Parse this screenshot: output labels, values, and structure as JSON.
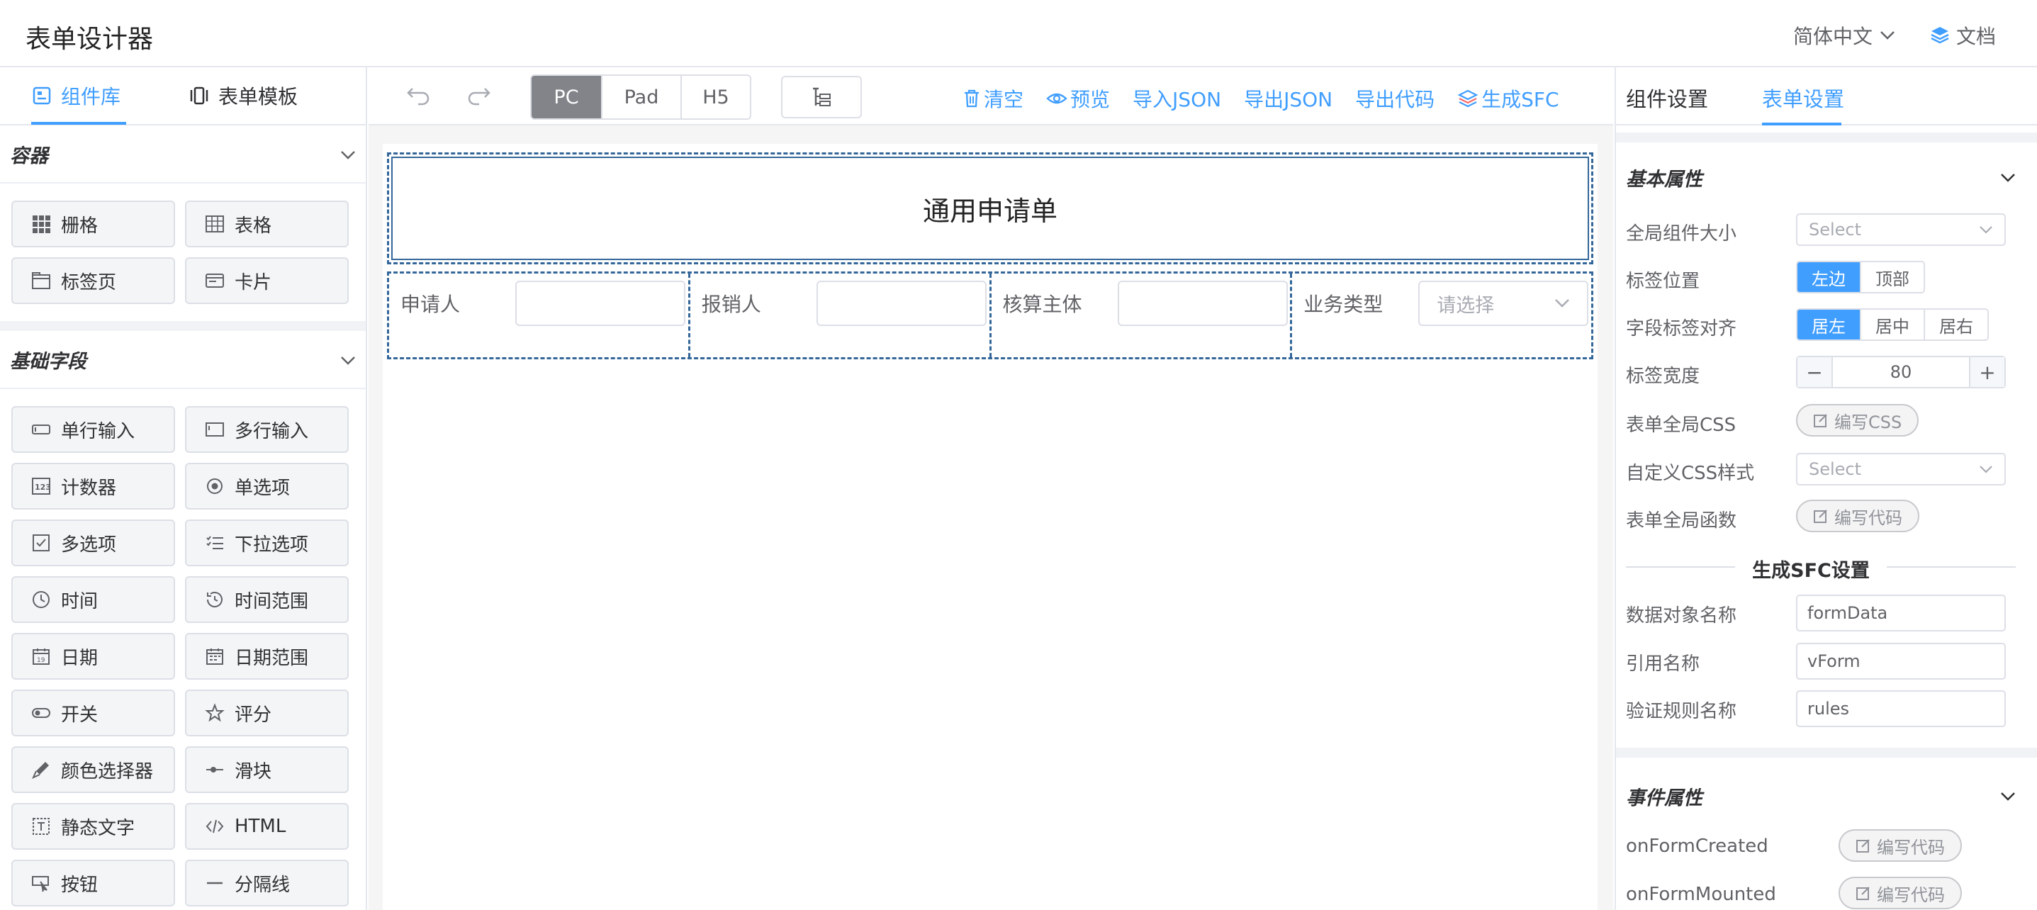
{
  "app": {
    "title": "表单设计器",
    "lang": "简体中文",
    "docs": "文档"
  },
  "left": {
    "tabs": [
      {
        "label": "组件库",
        "icon": "component-icon"
      },
      {
        "label": "表单模板",
        "icon": "template-icon"
      }
    ],
    "groups": [
      {
        "title": "容器",
        "items": [
          {
            "label": "栅格",
            "icon": "grid-icon"
          },
          {
            "label": "表格",
            "icon": "table-icon"
          },
          {
            "label": "标签页",
            "icon": "tab-icon"
          },
          {
            "label": "卡片",
            "icon": "card-icon"
          }
        ]
      },
      {
        "title": "基础字段",
        "items": [
          {
            "label": "单行输入",
            "icon": "text-input-icon"
          },
          {
            "label": "多行输入",
            "icon": "textarea-icon"
          },
          {
            "label": "计数器",
            "icon": "number-icon"
          },
          {
            "label": "单选项",
            "icon": "radio-icon"
          },
          {
            "label": "多选项",
            "icon": "checkbox-icon"
          },
          {
            "label": "下拉选项",
            "icon": "select-icon"
          },
          {
            "label": "时间",
            "icon": "clock-icon"
          },
          {
            "label": "时间范围",
            "icon": "time-range-icon"
          },
          {
            "label": "日期",
            "icon": "calendar-icon"
          },
          {
            "label": "日期范围",
            "icon": "date-range-icon"
          },
          {
            "label": "开关",
            "icon": "switch-icon"
          },
          {
            "label": "评分",
            "icon": "star-icon"
          },
          {
            "label": "颜色选择器",
            "icon": "color-picker-icon"
          },
          {
            "label": "滑块",
            "icon": "slider-icon"
          },
          {
            "label": "静态文字",
            "icon": "static-text-icon"
          },
          {
            "label": "HTML",
            "icon": "code-icon"
          },
          {
            "label": "按钮",
            "icon": "button-icon"
          },
          {
            "label": "分隔线",
            "icon": "divider-icon"
          }
        ]
      }
    ]
  },
  "toolbar": {
    "devices": [
      "PC",
      "Pad",
      "H5"
    ],
    "active_device": "PC",
    "actions": [
      "清空",
      "预览",
      "导入JSON",
      "导出JSON",
      "导出代码",
      "生成SFC"
    ]
  },
  "canvas": {
    "form_title": "通用申请单",
    "fields": [
      {
        "label": "申请人",
        "type": "input"
      },
      {
        "label": "报销人",
        "type": "input"
      },
      {
        "label": "核算主体",
        "type": "input"
      },
      {
        "label": "业务类型",
        "type": "select",
        "placeholder": "请选择"
      }
    ]
  },
  "right": {
    "tabs": [
      "组件设置",
      "表单设置"
    ],
    "active_tab": "表单设置",
    "basic_title": "基本属性",
    "props": {
      "size_label": "全局组件大小",
      "size_placeholder": "Select",
      "label_pos_label": "标签位置",
      "label_pos_options": [
        "左边",
        "顶部"
      ],
      "label_align_label": "字段标签对齐",
      "label_align_options": [
        "居左",
        "居中",
        "居右"
      ],
      "label_width_label": "标签宽度",
      "label_width_value": "80",
      "css_label": "表单全局CSS",
      "css_button": "编写CSS",
      "custom_css_label": "自定义CSS样式",
      "custom_css_placeholder": "Select",
      "func_label": "表单全局函数",
      "func_button": "编写代码"
    },
    "sfc": {
      "title": "生成SFC设置",
      "data_obj_label": "数据对象名称",
      "data_obj_value": "formData",
      "ref_label": "引用名称",
      "ref_value": "vForm",
      "rules_label": "验证规则名称",
      "rules_value": "rules"
    },
    "events": {
      "title": "事件属性",
      "items": [
        {
          "name": "onFormCreated",
          "button": "编写代码"
        },
        {
          "name": "onFormMounted",
          "button": "编写代码"
        }
      ]
    }
  },
  "colors": {
    "accent": "#409eff",
    "form_border": "#336699",
    "device_active": "#82848a"
  }
}
